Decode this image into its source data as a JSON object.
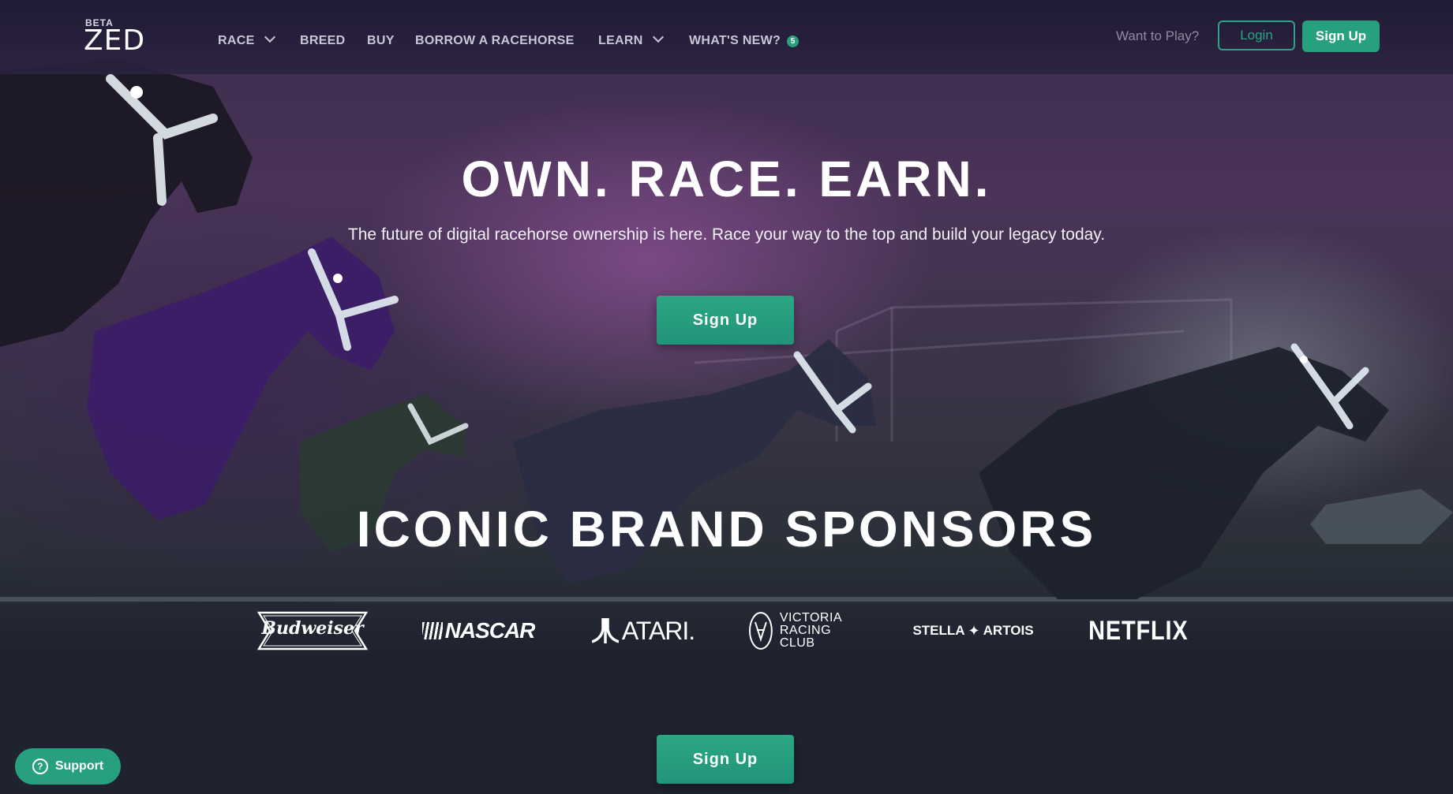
{
  "brand": {
    "beta_label": "BETA",
    "logo_text": "ZED"
  },
  "nav": {
    "items": [
      {
        "label": "RACE",
        "has_dropdown": true
      },
      {
        "label": "BREED",
        "has_dropdown": false
      },
      {
        "label": "BUY",
        "has_dropdown": false
      },
      {
        "label": "BORROW A RACEHORSE",
        "has_dropdown": false
      },
      {
        "label": "LEARN",
        "has_dropdown": true
      },
      {
        "label": "WHAT'S NEW?",
        "has_dropdown": false,
        "badge": "5"
      }
    ],
    "prompt": "Want to Play?",
    "login_label": "Login",
    "signup_label": "Sign Up"
  },
  "hero": {
    "headline": "OWN. RACE. EARN.",
    "subheadline": "The future of digital racehorse ownership is here. Race your way to the top and build your legacy today.",
    "cta_label": "Sign Up"
  },
  "sponsors": {
    "title": "ICONIC BRAND SPONSORS",
    "items": [
      {
        "name": "Budweiser"
      },
      {
        "name": "NASCAR"
      },
      {
        "name": "ATARI."
      },
      {
        "name_line1": "VICTORIA",
        "name_line2": "RACING CLUB"
      },
      {
        "name_left": "STELLA",
        "name_right": "ARTOIS"
      },
      {
        "name": "NETFLIX"
      }
    ]
  },
  "footer_cta_label": "Sign Up",
  "support_label": "Support",
  "colors": {
    "accent": "#27a07f",
    "nav_bg": "#221d3a",
    "page_bg": "#1f2330"
  }
}
